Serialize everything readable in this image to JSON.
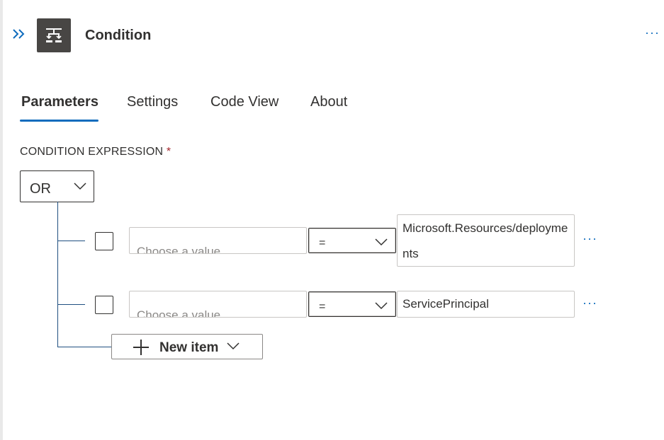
{
  "header": {
    "title": "Condition",
    "expand_icon": "double-chevron-right-icon",
    "action_icon": "condition-icon",
    "more_label": "···"
  },
  "tabs": [
    {
      "label": "Parameters",
      "active": true
    },
    {
      "label": "Settings",
      "active": false
    },
    {
      "label": "Code View",
      "active": false
    },
    {
      "label": "About",
      "active": false
    }
  ],
  "condition": {
    "section_label": "CONDITION EXPRESSION",
    "required_marker": "*",
    "group_operator": "OR",
    "rows": [
      {
        "left_placeholder": "Choose a value",
        "operator": "=",
        "right_value": "Microsoft.Resources/deployments",
        "more_label": "···"
      },
      {
        "left_placeholder": "Choose a value",
        "operator": "=",
        "right_value": "ServicePrincipal",
        "more_label": "···"
      }
    ],
    "new_item_label": "New item"
  },
  "colors": {
    "accent": "#0f6cbd",
    "tree_line": "#1f4f80",
    "required": "#a4262c"
  }
}
